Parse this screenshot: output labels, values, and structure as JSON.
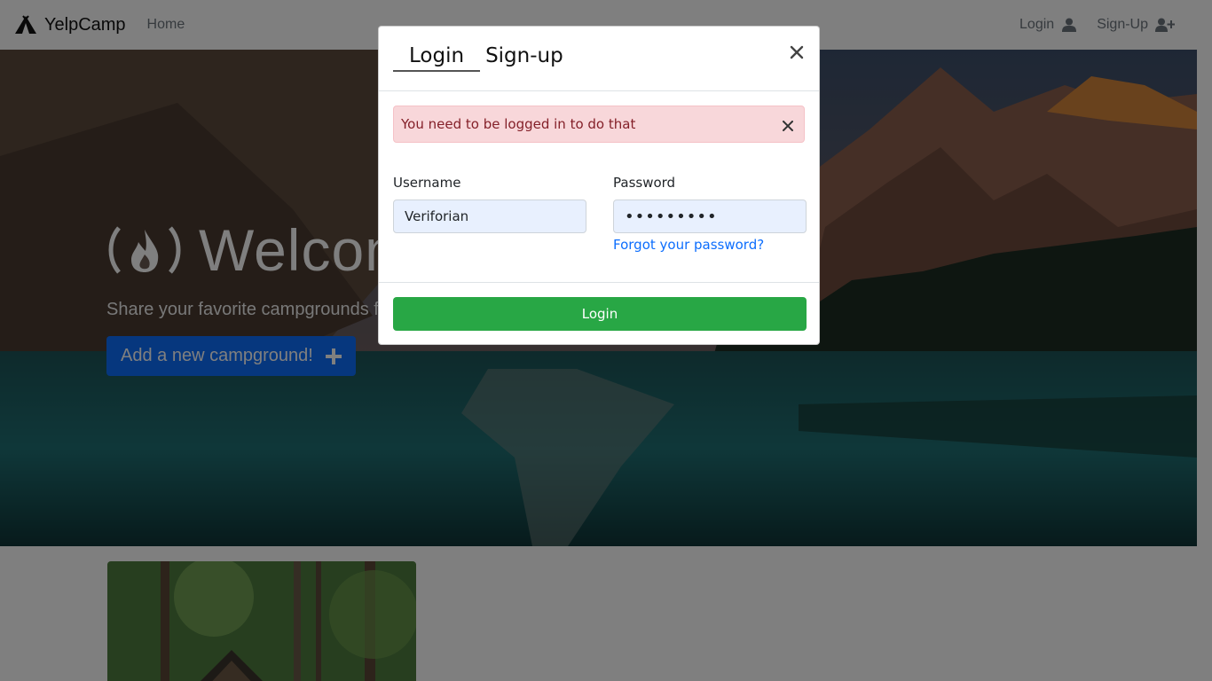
{
  "navbar": {
    "brand": "YelpCamp",
    "home": "Home",
    "login": "Login",
    "signup": "Sign-Up"
  },
  "hero": {
    "title": "Welcome",
    "subtitle": "Share your favorite campgrounds from all over the world!",
    "add_button": "Add a new campground!"
  },
  "modal": {
    "tabs": [
      "Login",
      "Sign-up"
    ],
    "active_tab": "Login",
    "alert_message": "You need to be logged in to do that",
    "username_label": "Username",
    "username_value": "Veriforian",
    "password_label": "Password",
    "password_value": "•••••••••",
    "forgot_link": "Forgot your password?",
    "login_button": "Login"
  },
  "colors": {
    "primary_button": "#0d6efd",
    "login_button": "#28a745",
    "alert_bg": "#f8d7da",
    "alert_text": "#842029",
    "link": "#0d6efd"
  },
  "icons": {
    "brand": "tent-icon",
    "login": "user-icon",
    "signup": "user-plus-icon",
    "hero_title": "fire-icon",
    "add_button": "plus-icon",
    "modal_close": "close-icon",
    "alert_close": "close-icon"
  }
}
